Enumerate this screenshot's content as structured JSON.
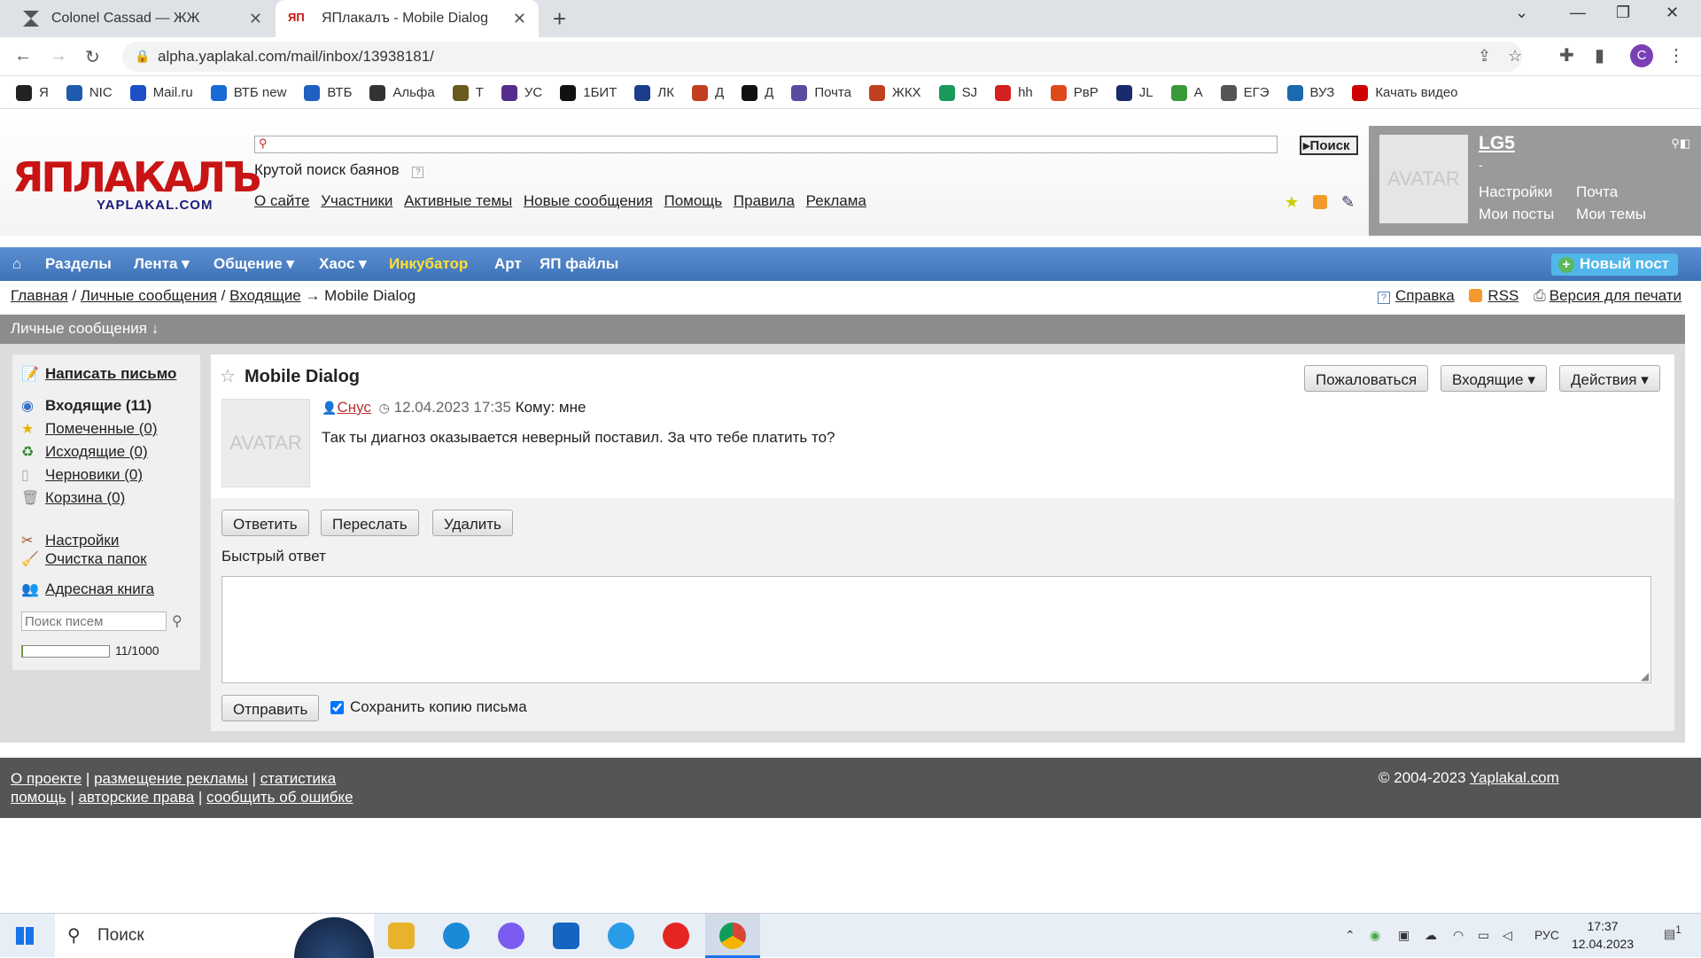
{
  "browser": {
    "tabs": [
      {
        "title": "Colonel Cassad — ЖЖ"
      },
      {
        "title": "ЯПлакалъ - Mobile Dialog"
      }
    ],
    "url": "alpha.yaplakal.com/mail/inbox/13938181/",
    "profile_initial": "C",
    "bookmarks": [
      "Я",
      "NIC",
      "Mail.ru",
      "ВТБ new",
      "ВТБ",
      "Альфа",
      "Т",
      "УС",
      "1БИТ",
      "ЛК",
      "Д",
      "Д",
      "Почта",
      "ЖКХ",
      "SJ",
      "hh",
      "РвР",
      "JL",
      "А",
      "ЕГЭ",
      "ВУЗ",
      "Качать видео"
    ]
  },
  "site": {
    "logo_main": "ЯПЛАКАЛЪ",
    "logo_sub": "YAPLAKAL.COM",
    "search_button": "Поиск",
    "search_label": "Крутой поиск баянов",
    "top_links": [
      "О сайте",
      "Участники",
      "Активные темы",
      "Новые сообщения",
      "Помощь",
      "Правила",
      "Реклама"
    ],
    "user": {
      "avatar_text": "AVATAR",
      "name": "LG5",
      "dash": "-",
      "links": [
        "Настройки",
        "Почта",
        "Мои посты",
        "Мои темы"
      ]
    },
    "menu": [
      "Разделы",
      "Лента",
      "Общение",
      "Хаос",
      "Инкубатор",
      "Арт",
      "ЯП файлы"
    ],
    "new_post": "Новый пост"
  },
  "breadcrumb": {
    "home": "Главная",
    "pm": "Личные сообщения",
    "inbox": "Входящие",
    "current": "→ Mobile Dialog",
    "sep": "/",
    "help": "Справка",
    "rss": "RSS",
    "print": "Версия для печати"
  },
  "section_title": "Личные сообщения ↓",
  "sidebar": {
    "compose": "Написать письмо",
    "folders": [
      {
        "label": "Входящие (11)"
      },
      {
        "label": "Помеченные (0)"
      },
      {
        "label": "Исходящие (0)"
      },
      {
        "label": "Черновики (0)"
      },
      {
        "label": "Корзина (0)"
      }
    ],
    "settings": "Настройки",
    "cleanup": "Очистка папок",
    "address_book": "Адресная книга",
    "search_placeholder": "Поиск писем",
    "quota": "11/1000",
    "quota_fraction": 0.011
  },
  "message": {
    "title": "Mobile Dialog",
    "avatar_text": "AVATAR",
    "author": "Снус",
    "datetime": "12.04.2023 17:35",
    "to": "Кому: мне",
    "body": "Так ты диагноз оказывается неверный поставил. За что тебе платить то?",
    "buttons": {
      "report": "Пожаловаться",
      "inbox": "Входящие ▾",
      "actions": "Действия ▾"
    },
    "reply": "Ответить",
    "forward": "Переслать",
    "delete": "Удалить",
    "quick_reply_label": "Быстрый ответ",
    "send": "Отправить",
    "save_copy": "Сохранить копию письма"
  },
  "footer": {
    "row1": [
      "О проекте",
      "размещение рекламы",
      "статистика"
    ],
    "row2": [
      "помощь",
      "авторские права",
      "сообщить об ошибке"
    ],
    "copyright": "© 2004-2023",
    "site_link": "Yaplakal.com"
  },
  "taskbar": {
    "search": "Поиск",
    "lang": "РУС",
    "time": "17:37",
    "date": "12.04.2023",
    "notif_count": "1"
  },
  "colors": {
    "menu_blue": "#4a80c4",
    "incubator": "#ffe033",
    "logo_red": "#c81414"
  }
}
